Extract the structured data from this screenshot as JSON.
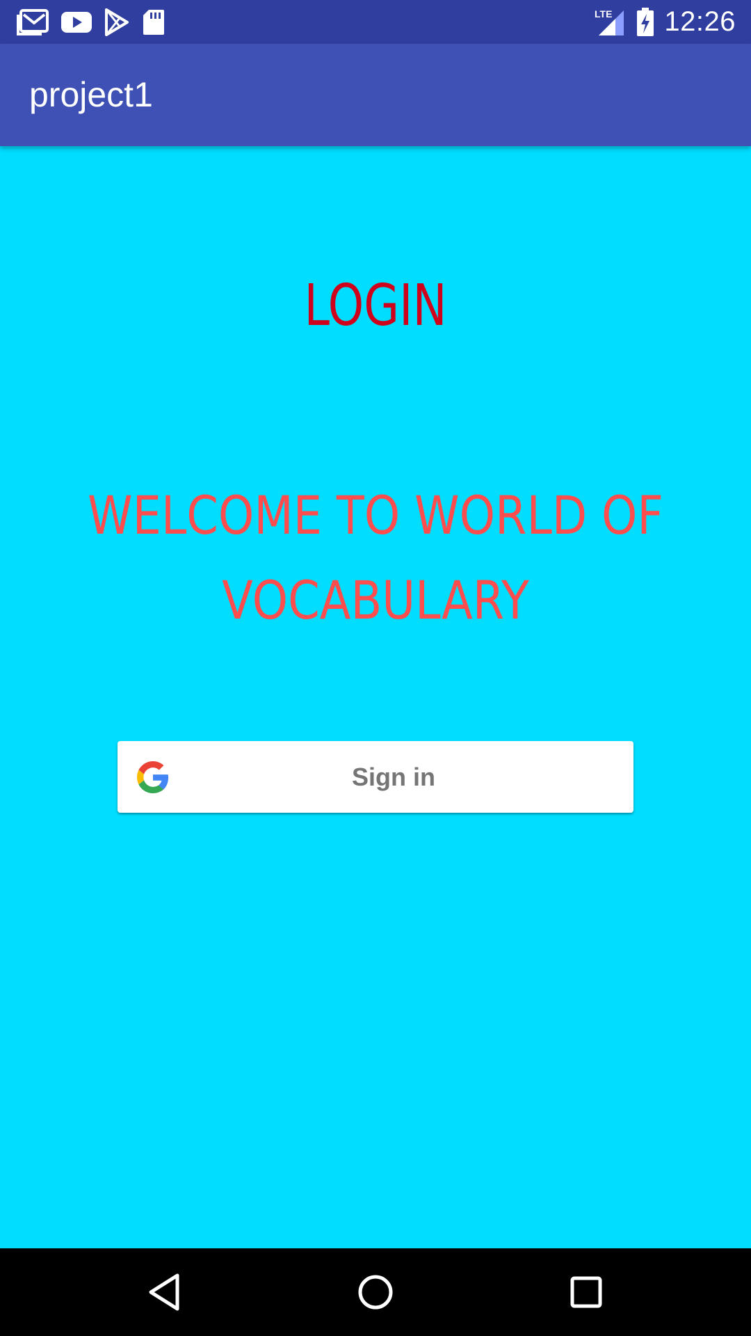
{
  "status_bar": {
    "time": "12:26",
    "network": "LTE",
    "icons": [
      "gmail-icon",
      "youtube-icon",
      "play-store-icon",
      "sd-card-icon",
      "lte-signal-icon",
      "battery-charging-icon"
    ]
  },
  "app_bar": {
    "title": "project1"
  },
  "main": {
    "login_title": "LOGIN",
    "welcome_text": "WELCOME TO WORLD OF VOCABULARY",
    "signin_button": {
      "label": "Sign in",
      "icon": "google-icon"
    }
  },
  "nav_bar": {
    "buttons": [
      "back-icon",
      "home-icon",
      "recents-icon"
    ]
  },
  "colors": {
    "status_bar": "#303F9F",
    "app_bar": "#3F51B5",
    "background": "#00DDFF",
    "login_title": "#D0021B",
    "welcome_text": "#FF4D4D",
    "signin_label": "#757575",
    "nav_bar": "#000000"
  }
}
